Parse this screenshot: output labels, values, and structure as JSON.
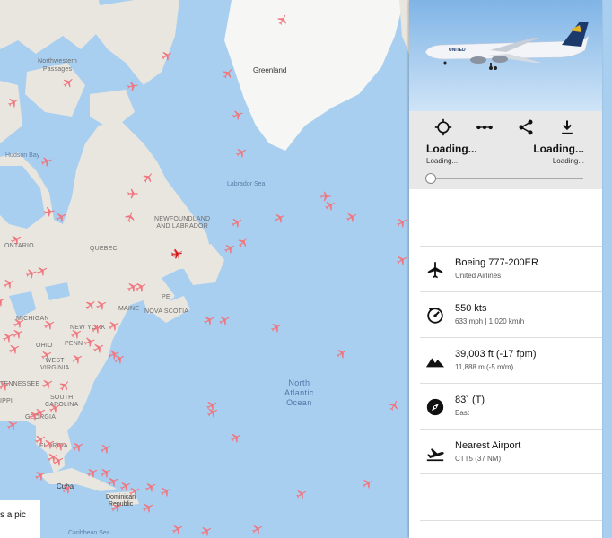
{
  "map": {
    "labels": {
      "northwestern_passages": "Northwestern\nPassages",
      "greenland": "Greenland",
      "hudson_bay": "Hudson Bay",
      "labrador_sea": "Labrador Sea",
      "newfoundland": "NEWFOUNDLAND\nAND LABRADOR",
      "ontario": "ONTARIO",
      "quebec": "QUEBEC",
      "pe": "PE",
      "nova_scotia": "NOVA SCOTIA",
      "maine": "MAINE",
      "michigan": "MICHIGAN",
      "new_york": "NEW YORK",
      "ohio": "OHIO",
      "penn": "PENN",
      "west_virginia": "WEST\nVIRGINIA",
      "tennessee": "TENNESSEE",
      "south_carolina": "SOUTH\nCAROLINA",
      "georgia": "GEORGIA",
      "florida": "FLORIDA",
      "ippi": "IPPI",
      "north_atlantic": "North\nAtlantic\nOcean",
      "cuba": "Cuba",
      "dominican_republic": "Dominican\nRepublic",
      "caribbean_sea": "Caribbean Sea"
    }
  },
  "caption": {
    "text": "s a pic"
  },
  "panel": {
    "photo": {
      "airline_livery_text": "UNITED"
    },
    "toolbar": {
      "locate_icon": "crosshair-icon",
      "route_icon": "route-dots-icon",
      "share_icon": "share-icon",
      "download_icon": "download-icon",
      "origin_main": "Loading...",
      "origin_sub": "Loading...",
      "destination_main": "Loading...",
      "destination_sub": "Loading...",
      "progress": 0
    },
    "info": {
      "aircraft": {
        "icon": "airplane-icon",
        "main": "Boeing 777-200ER",
        "sub": "United Airlines"
      },
      "speed": {
        "icon": "speedometer-icon",
        "main": "550 kts",
        "sub": "633 mph | 1,020 km/h"
      },
      "altitude": {
        "icon": "mountain-icon",
        "main": "39,003 ft (-17 fpm)",
        "sub": "11,888 m (-5 m/m)"
      },
      "heading": {
        "icon": "compass-icon",
        "main": "83˚ (T)",
        "sub": "East"
      },
      "nearest_airport": {
        "icon": "takeoff-icon",
        "main": "Nearest Airport",
        "sub": "CTT5 (37 NM)"
      }
    }
  },
  "colors": {
    "ocean": "#a9cff0",
    "land": "#e9e6df",
    "greenland": "#f6f6f4",
    "plane": "#f0767f",
    "selected_plane": "#d11d1d",
    "toolbar": "#e8e8e8"
  }
}
